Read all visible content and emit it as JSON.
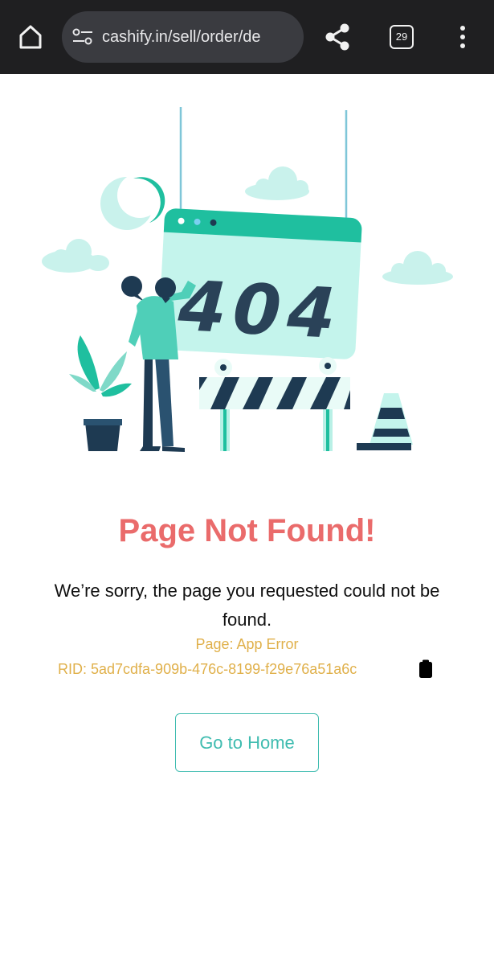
{
  "browser": {
    "url": "cashify.in/sell/order/de",
    "tab_count": "29",
    "icons": [
      "home-icon",
      "site-settings-icon",
      "share-icon",
      "tabs-icon",
      "more-vert-icon"
    ]
  },
  "illustration": {
    "sign_text": "404",
    "colors": {
      "teal": "#1fbf9f",
      "mint": "#c4f4ec",
      "navy": "#1e3a52",
      "cloud": "#c9f2ec"
    }
  },
  "main": {
    "title": "Page Not Found!",
    "message": "We’re sorry, the page you requested could not be found.",
    "page_info": "Page: App Error",
    "rid": "RID: 5ad7cdfa-909b-476c-8199-f29e76a51a6c",
    "home_button": "Go to Home"
  },
  "colors": {
    "title": "#ea6b6b",
    "info": "#e0b04a",
    "button": "#3fbcb0",
    "toolbar": "#1f1f21"
  }
}
